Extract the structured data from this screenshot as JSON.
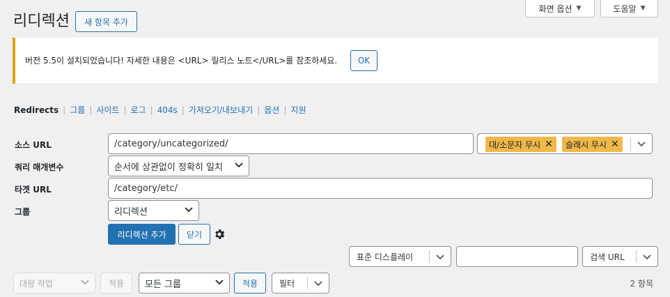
{
  "screen_tabs": {
    "screen_options": "화면 옵션",
    "help": "도움말"
  },
  "header": {
    "title": "리디렉션",
    "add_new": "새 항목 추가"
  },
  "notice": {
    "text": "버전 5.5이 설치되었습니다! 자세한 내용은 <URL> 릴리스 노트</URL>를 참조하세요.",
    "ok": "OK"
  },
  "subnav": {
    "items": [
      "Redirects",
      "그룹",
      "사이트",
      "로그",
      "404s",
      "가져오기/내보내기",
      "옵션",
      "지원"
    ]
  },
  "form": {
    "source_label": "소스 URL",
    "source_value": "/category/uncategorized/",
    "tags": [
      "대/소문자 무시",
      "슬래시 무시"
    ],
    "query_label": "쿼리 매개변수",
    "query_value": "순서에 상관없이 정확히 일치",
    "target_label": "타겟 URL",
    "target_value": "/category/etc/",
    "group_label": "그룹",
    "group_value": "리디렉션",
    "add_button": "리디렉션 추가",
    "close_button": "닫기"
  },
  "search": {
    "display_select": "표준 디스플레이",
    "search_value": "",
    "search_button": "검색 URL"
  },
  "bulk": {
    "bulk_action": "대량 작업",
    "apply1": "적용",
    "group_filter": "모든 그룹",
    "apply2": "적용",
    "filter": "필터",
    "count": "2 항목"
  },
  "colors": {
    "accent": "#2271b1",
    "warning": "#dba617",
    "tag": "#f0b849"
  }
}
